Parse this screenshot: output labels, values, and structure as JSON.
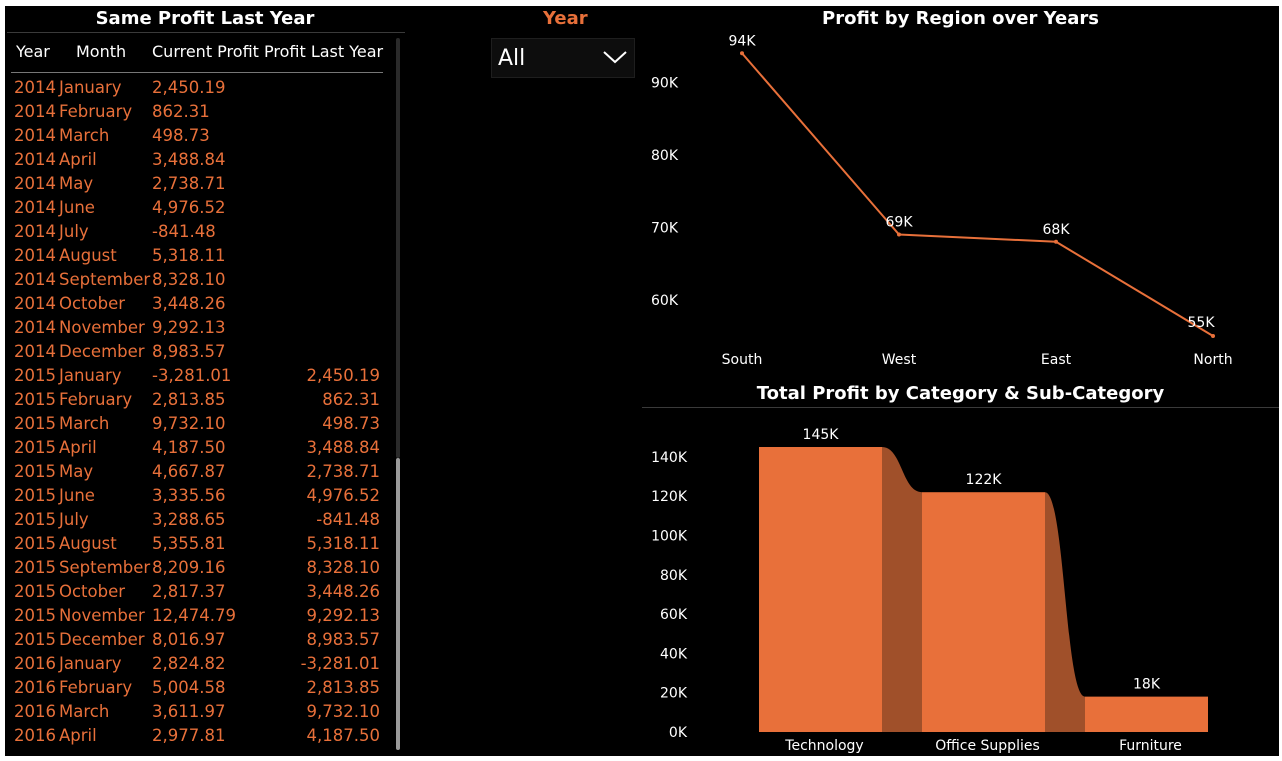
{
  "table": {
    "title": "Same Profit Last Year",
    "headers": {
      "year": "Year",
      "month": "Month",
      "current": "Current Profit",
      "last": "Profit Last Year"
    },
    "rows": [
      {
        "year": "2014",
        "month": "January",
        "current": "2,450.19",
        "last": ""
      },
      {
        "year": "2014",
        "month": "February",
        "current": "862.31",
        "last": ""
      },
      {
        "year": "2014",
        "month": "March",
        "current": "498.73",
        "last": ""
      },
      {
        "year": "2014",
        "month": "April",
        "current": "3,488.84",
        "last": ""
      },
      {
        "year": "2014",
        "month": "May",
        "current": "2,738.71",
        "last": ""
      },
      {
        "year": "2014",
        "month": "June",
        "current": "4,976.52",
        "last": ""
      },
      {
        "year": "2014",
        "month": "July",
        "current": "-841.48",
        "last": ""
      },
      {
        "year": "2014",
        "month": "August",
        "current": "5,318.11",
        "last": ""
      },
      {
        "year": "2014",
        "month": "September",
        "current": "8,328.10",
        "last": ""
      },
      {
        "year": "2014",
        "month": "October",
        "current": "3,448.26",
        "last": ""
      },
      {
        "year": "2014",
        "month": "November",
        "current": "9,292.13",
        "last": ""
      },
      {
        "year": "2014",
        "month": "December",
        "current": "8,983.57",
        "last": ""
      },
      {
        "year": "2015",
        "month": "January",
        "current": "-3,281.01",
        "last": "2,450.19"
      },
      {
        "year": "2015",
        "month": "February",
        "current": "2,813.85",
        "last": "862.31"
      },
      {
        "year": "2015",
        "month": "March",
        "current": "9,732.10",
        "last": "498.73"
      },
      {
        "year": "2015",
        "month": "April",
        "current": "4,187.50",
        "last": "3,488.84"
      },
      {
        "year": "2015",
        "month": "May",
        "current": "4,667.87",
        "last": "2,738.71"
      },
      {
        "year": "2015",
        "month": "June",
        "current": "3,335.56",
        "last": "4,976.52"
      },
      {
        "year": "2015",
        "month": "July",
        "current": "3,288.65",
        "last": "-841.48"
      },
      {
        "year": "2015",
        "month": "August",
        "current": "5,355.81",
        "last": "5,318.11"
      },
      {
        "year": "2015",
        "month": "September",
        "current": "8,209.16",
        "last": "8,328.10"
      },
      {
        "year": "2015",
        "month": "October",
        "current": "2,817.37",
        "last": "3,448.26"
      },
      {
        "year": "2015",
        "month": "November",
        "current": "12,474.79",
        "last": "9,292.13"
      },
      {
        "year": "2015",
        "month": "December",
        "current": "8,016.97",
        "last": "8,983.57"
      },
      {
        "year": "2016",
        "month": "January",
        "current": "2,824.82",
        "last": "-3,281.01"
      },
      {
        "year": "2016",
        "month": "February",
        "current": "5,004.58",
        "last": "2,813.85"
      },
      {
        "year": "2016",
        "month": "March",
        "current": "3,611.97",
        "last": "9,732.10"
      },
      {
        "year": "2016",
        "month": "April",
        "current": "2,977.81",
        "last": "4,187.50"
      }
    ]
  },
  "slicer": {
    "title": "Year",
    "value": "All",
    "icon": "chevron-down-icon"
  },
  "colors": {
    "accent": "#e8703a",
    "ribbon": "#a0502a",
    "background": "#000000",
    "text": "#ffffff"
  },
  "chart_data": [
    {
      "type": "line",
      "title": "Profit by Region over Years",
      "categories": [
        "South",
        "West",
        "East",
        "North"
      ],
      "values": [
        94000,
        69000,
        68000,
        55000
      ],
      "data_labels": [
        "94K",
        "69K",
        "68K",
        "55K"
      ],
      "yticks": [
        "60K",
        "70K",
        "80K",
        "90K"
      ],
      "ytick_values": [
        60000,
        70000,
        80000,
        90000
      ],
      "ylim": [
        55000,
        95000
      ],
      "grid": false
    },
    {
      "type": "bar",
      "title": "Total Profit by Category & Sub-Category",
      "categories": [
        "Technology",
        "Office Supplies",
        "Furniture"
      ],
      "values": [
        145000,
        122000,
        18000
      ],
      "data_labels": [
        "145K",
        "122K",
        "18K"
      ],
      "yticks": [
        "0K",
        "20K",
        "40K",
        "60K",
        "80K",
        "100K",
        "120K",
        "140K"
      ],
      "ytick_values": [
        0,
        20000,
        40000,
        60000,
        80000,
        100000,
        120000,
        140000
      ],
      "ylim": [
        0,
        145000
      ],
      "grid": false
    }
  ]
}
